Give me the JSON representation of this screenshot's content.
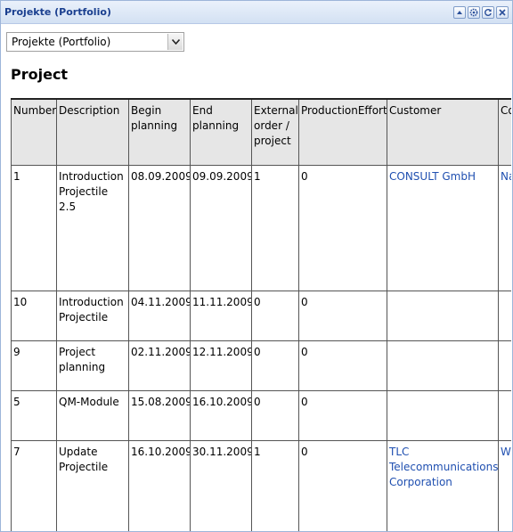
{
  "window": {
    "title": "Projekte (Portfolio)",
    "buttons": [
      "minimize-icon",
      "settings-icon",
      "refresh-icon",
      "close-icon"
    ]
  },
  "selector": {
    "value": "Projekte (Portfolio)"
  },
  "heading": "Project",
  "table": {
    "columns": [
      "Number",
      "Description",
      "Begin planning",
      "End planning",
      "External order / project",
      "ProductionEffort",
      "Customer",
      "Co"
    ],
    "rows": [
      {
        "number": "1",
        "description": "Introduction Projectile 2.5",
        "begin": "08.09.2009",
        "end": "09.09.2009",
        "external": "1",
        "effort": "0",
        "customer": "CONSULT GmbH",
        "contact": "Na Lis"
      },
      {
        "number": "10",
        "description": "Introduction Projectile",
        "begin": "04.11.2009",
        "end": "11.11.2009",
        "external": "0",
        "effort": "0",
        "customer": "",
        "contact": ""
      },
      {
        "number": "9",
        "description": "Project planning",
        "begin": "02.11.2009",
        "end": "12.11.2009",
        "external": "0",
        "effort": "0",
        "customer": "",
        "contact": ""
      },
      {
        "number": "5",
        "description": "QM-Module",
        "begin": "15.08.2009",
        "end": "16.10.2009",
        "external": "0",
        "effort": "0",
        "customer": "",
        "contact": ""
      },
      {
        "number": "7",
        "description": "Update Projectile",
        "begin": "16.10.2009",
        "end": "30.11.2009",
        "external": "1",
        "effort": "0",
        "customer": "TLC Telecommunications Corporation",
        "contact": "W Ge"
      }
    ]
  },
  "colors": {
    "title_text": "#1a3f8f",
    "link": "#1f4fb0",
    "header_bg": "#e6e6e6"
  }
}
